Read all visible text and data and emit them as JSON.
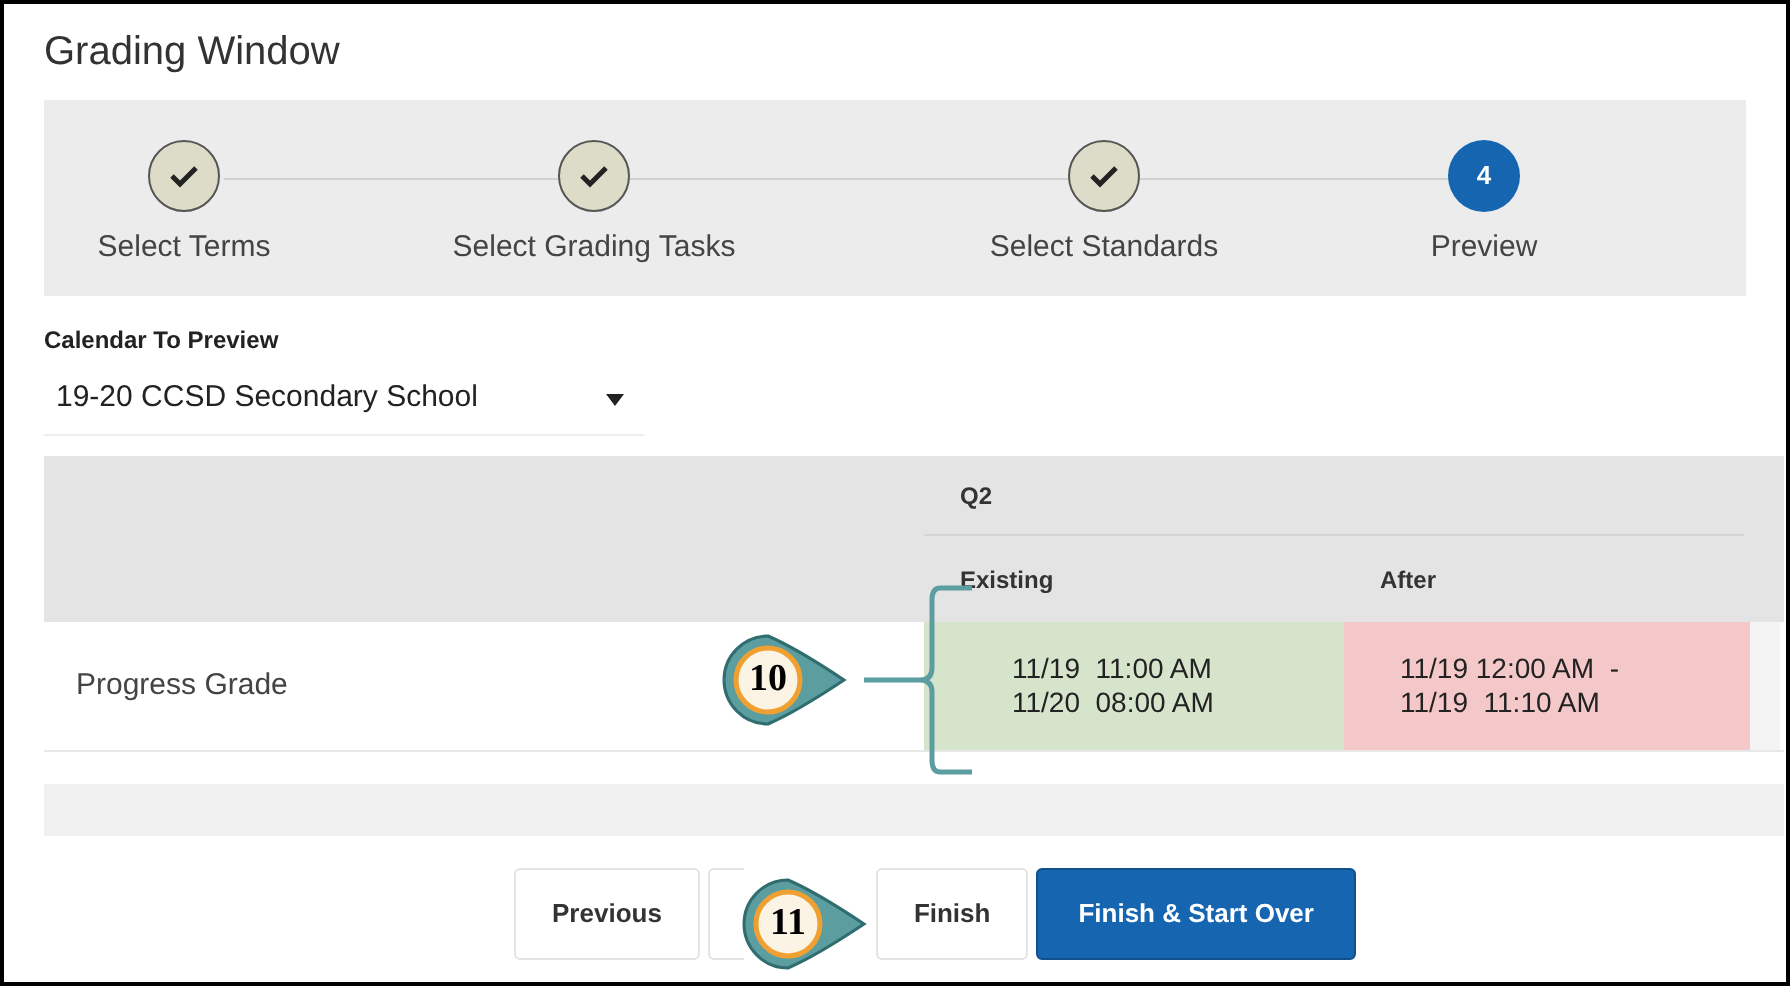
{
  "window": {
    "title": "Grading Window"
  },
  "steps": [
    {
      "label": "Select Terms",
      "completed": true
    },
    {
      "label": "Select Grading Tasks",
      "completed": true
    },
    {
      "label": "Select Standards",
      "completed": true
    },
    {
      "label": "Preview",
      "completed": false,
      "number": "4"
    }
  ],
  "calendar": {
    "label": "Calendar To Preview",
    "value": "19-20 CCSD Secondary School"
  },
  "table": {
    "group_header": "Q2",
    "columns": [
      "Existing",
      "After"
    ],
    "rows": [
      {
        "name": "Progress Grade",
        "existing": [
          "11/19  11:00 AM",
          "11/20  08:00 AM"
        ],
        "after": [
          "11/19 12:00 AM  -",
          "11/19  11:10 AM"
        ]
      }
    ]
  },
  "callouts": [
    {
      "label": "10"
    },
    {
      "label": "11"
    }
  ],
  "buttons": [
    {
      "label": "Previous",
      "kind": "secondary"
    },
    {
      "kind": "secondary"
    },
    {
      "label": "Finish",
      "kind": "secondary"
    },
    {
      "label": "Finish & Start Over",
      "kind": "primary"
    }
  ]
}
